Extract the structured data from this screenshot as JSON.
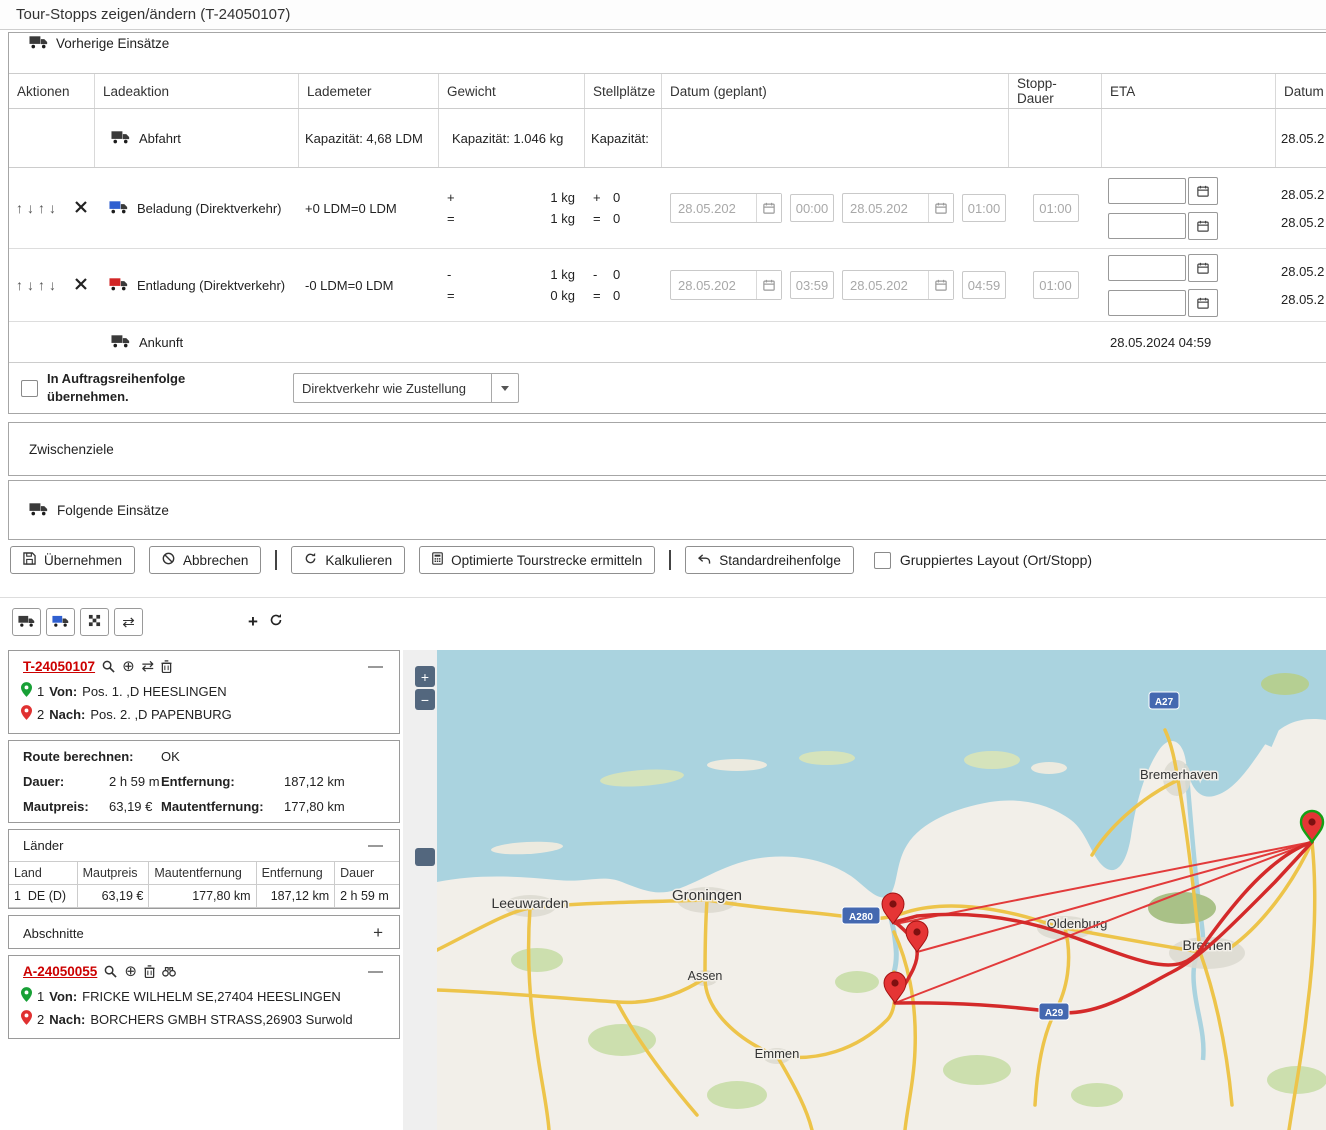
{
  "title": "Tour-Stopps zeigen/ändern (T-24050107)",
  "prev_section": {
    "label": "Vorherige Einsätze"
  },
  "icons": {
    "up": "↑",
    "down": "↓",
    "swap": "⇄",
    "crosshair": "⊕",
    "plus": "+",
    "minus": "—"
  },
  "table": {
    "headers": [
      "Aktionen",
      "Ladeaktion",
      "Lademeter",
      "Gewicht",
      "Stellplätze",
      "Datum (geplant)",
      "Stopp-Dauer",
      "ETA",
      "Datum"
    ],
    "abfahrt": {
      "label": "Abfahrt",
      "lademeter": "Kapazität: 4,68 LDM",
      "gewicht": "Kapazität: 1.046 kg",
      "stellplaetze": "Kapazität:",
      "datum": "28.05.2"
    },
    "beladung": {
      "label": "Beladung (Direktverkehr)",
      "lademeter": "+0 LDM=0 LDM",
      "gewicht_op1": "+",
      "gewicht_val1": "1 kg",
      "gewicht_op2": "=",
      "gewicht_val2": "1 kg",
      "stell_op1": "+",
      "stell_val1": "0",
      "stell_op2": "=",
      "stell_val2": "0",
      "plan_from_date": "28.05.202",
      "plan_from_time": "00:00",
      "plan_to_date": "28.05.202",
      "plan_to_time": "01:00",
      "stopp_dauer": "01:00",
      "datum1": "28.05.2",
      "datum2": "28.05.2"
    },
    "entladung": {
      "label": "Entladung (Direktverkehr)",
      "lademeter": "-0 LDM=0 LDM",
      "gewicht_op1": "-",
      "gewicht_val1": "1 kg",
      "gewicht_op2": "=",
      "gewicht_val2": "0 kg",
      "stell_op1": "-",
      "stell_val1": "0",
      "stell_op2": "=",
      "stell_val2": "0",
      "plan_from_date": "28.05.202",
      "plan_from_time": "03:59",
      "plan_to_date": "28.05.202",
      "plan_to_time": "04:59",
      "stopp_dauer": "01:00",
      "datum1": "28.05.2",
      "datum2": "28.05.2"
    },
    "ankunft": {
      "label": "Ankunft",
      "eta": "28.05.2024 04:59"
    }
  },
  "order_options": {
    "checkbox_label": "In Auftragsreihenfolge übernehmen.",
    "select_value": "Direktverkehr wie Zustellung"
  },
  "zwischenziele": {
    "label": "Zwischenziele"
  },
  "folgende": {
    "label": "Folgende Einsätze"
  },
  "actions": {
    "uebernehmen": "Übernehmen",
    "abbrechen": "Abbrechen",
    "kalkulieren": "Kalkulieren",
    "optimierte": "Optimierte Tourstrecke ermitteln",
    "standard": "Standardreihenfolge",
    "gruppiert": "Gruppiertes Layout (Ort/Stopp)"
  },
  "panel": {
    "tour": {
      "id": "T-24050107",
      "von_num": "1",
      "von_label": "Von:",
      "von_value": "Pos. 1. ,D HEESLINGEN",
      "nach_num": "2",
      "nach_label": "Nach:",
      "nach_value": "Pos. 2. ,D PAPENBURG"
    },
    "route": {
      "berechnen_label": "Route berechnen:",
      "berechnen_value": "OK",
      "dauer_label": "Dauer:",
      "dauer_value": "2 h 59 m",
      "entfernung_label": "Entfernung:",
      "entfernung_value": "187,12 km",
      "mautpreis_label": "Mautpreis:",
      "mautpreis_value": "63,19 €",
      "mautentfernung_label": "Mautentfernung:",
      "mautentfernung_value": "177,80 km"
    },
    "laender": {
      "title": "Länder",
      "headers": [
        "Land",
        "Mautpreis",
        "Mautentfernung",
        "Entfernung",
        "Dauer"
      ],
      "row": {
        "num": "1",
        "land": "DE (D)",
        "mautpreis": "63,19 €",
        "mautentfernung": "177,80 km",
        "entfernung": "187,12 km",
        "dauer": "2 h 59 m"
      }
    },
    "abschnitte": {
      "title": "Abschnitte"
    },
    "auftrag": {
      "id": "A-24050055",
      "von_num": "1",
      "von_label": "Von:",
      "von_value": "FRICKE WILHELM SE,27404 HEESLINGEN",
      "nach_num": "2",
      "nach_label": "Nach:",
      "nach_value": "BORCHERS GMBH STRASS,26903 Surwold"
    }
  },
  "map": {
    "zoom_in": "+",
    "zoom_out": "−",
    "cities": {
      "leeuwarden": "Leeuwarden",
      "groningen": "Groningen",
      "assen": "Assen",
      "emmen": "Emmen",
      "oldenburg": "Oldenburg",
      "bremen": "Bremen",
      "bremerhaven": "Bremerhaven"
    },
    "badges": {
      "a280": "A280",
      "a29": "A29",
      "a27": "A27"
    }
  }
}
